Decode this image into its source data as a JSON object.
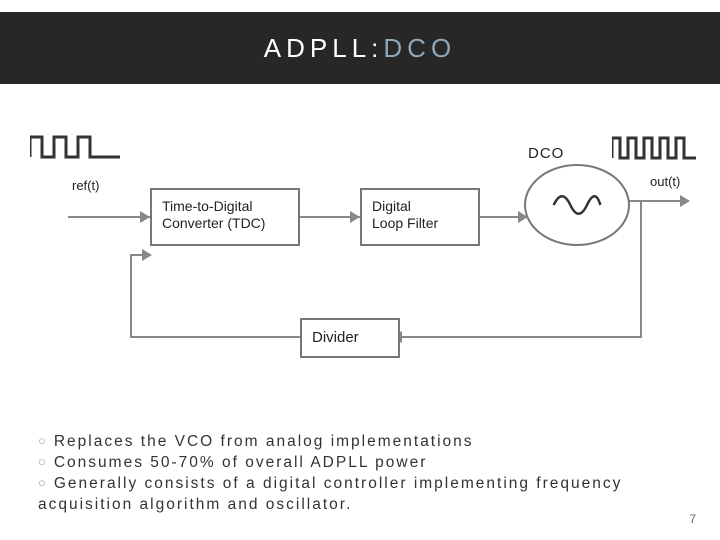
{
  "title": {
    "part1": "ADPLL: ",
    "part2": "DCO"
  },
  "labels": {
    "dco": "DCO",
    "ref": "ref(t)",
    "out": "out(t)"
  },
  "blocks": {
    "tdc": "Time-to-Digital Converter (TDC)",
    "dlf_l1": "Digital",
    "dlf_l2": "Loop Filter",
    "divider": "Divider"
  },
  "bullets": [
    "Replaces the VCO from analog implementations",
    "Consumes 50-70% of overall ADPLL power",
    "Generally consists of a digital controller implementing frequency acquisition algorithm and oscillator."
  ],
  "page": "7"
}
